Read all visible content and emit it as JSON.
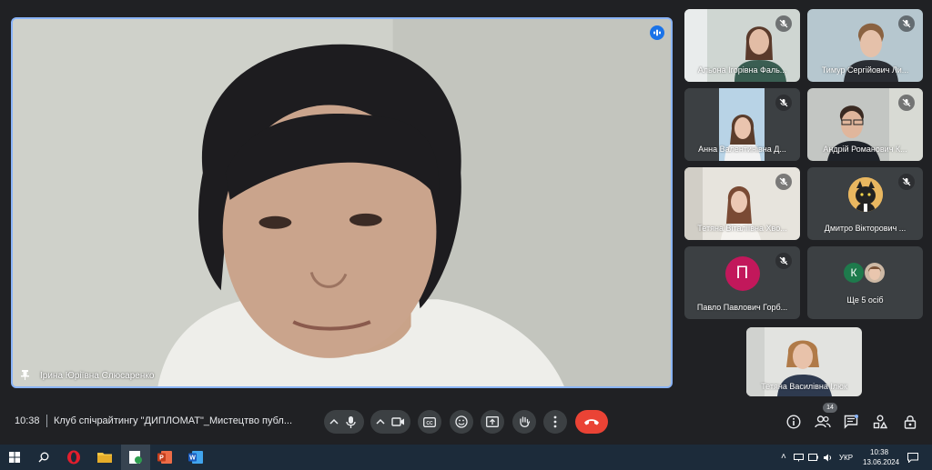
{
  "main_speaker": {
    "name": "Ірина Юріївна Слюсаренко"
  },
  "participants": [
    {
      "name": "Альона Ігорівна Фаль...",
      "muted": true
    },
    {
      "name": "Тимур Сергійович Ли...",
      "muted": true
    },
    {
      "name": "Анна Валентинівна Д...",
      "muted": true
    },
    {
      "name": "Андрій Романович К...",
      "muted": true
    },
    {
      "name": "Тетяна Віталіївна Хво...",
      "muted": true
    },
    {
      "name": "Дмитро Вікторович ...",
      "muted": true
    },
    {
      "name": "Павло Павлович Горб...",
      "avatar_letter": "П",
      "muted": true
    },
    {
      "name": "Ще 5 осіб",
      "avatar_letter": "К"
    }
  ],
  "self_view": {
    "name": "Тетяна Василівна Ілюк"
  },
  "bottom_bar": {
    "time": "10:38",
    "meeting_title": "Клуб спічрайтингу \"ДИПЛОМАТ\"_Мистецтво публ...",
    "people_count": "14"
  },
  "taskbar": {
    "language": "УКР",
    "time": "10:38",
    "date": "13.06.2024"
  },
  "colors": {
    "end_call": "#ea4335",
    "active_speaker_border": "#8ab4f8",
    "avatar_p": "#c2185b",
    "avatar_k": "#1e7a4c"
  }
}
